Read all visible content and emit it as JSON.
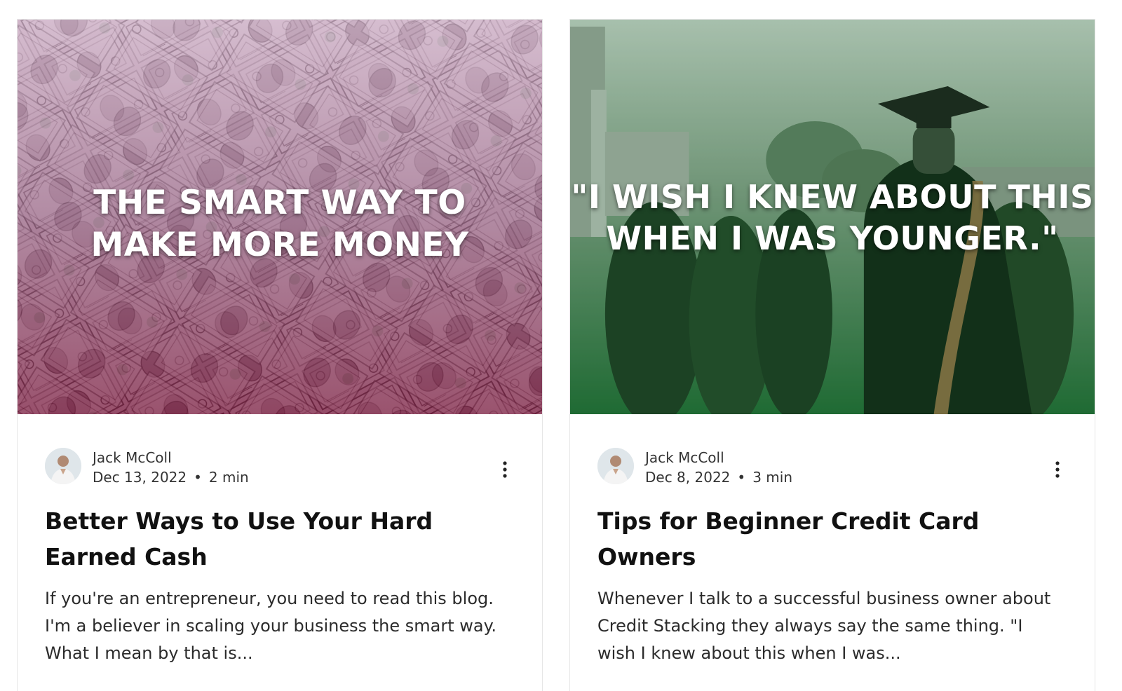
{
  "posts": [
    {
      "cover_text_line1": "THE SMART WAY TO",
      "cover_text_line2": "MAKE MORE MONEY",
      "author": "Jack McColl",
      "date": "Dec 13, 2022",
      "separator": "•",
      "read_time": "2 min",
      "title": "Better Ways to Use Your Hard Earned Cash",
      "excerpt": "If you're an entrepreneur, you need to read this blog. I'm a believer in scaling your business the smart way. What I mean by that is..."
    },
    {
      "cover_text_line1": "\"I WISH I KNEW ABOUT THIS",
      "cover_text_line2": "WHEN I WAS YOUNGER.\"",
      "author": "Jack McColl",
      "date": "Dec 8, 2022",
      "separator": "•",
      "read_time": "3 min",
      "title": "Tips for Beginner Credit Card Owners",
      "excerpt": "Whenever I talk to a successful business owner about Credit Stacking they always say the same thing. \"I wish I knew about this when I was..."
    }
  ],
  "colors": {
    "left_cover_top": "#c9a7c0",
    "left_cover_bottom": "#7a1c3e",
    "right_cover_top": "#b8c9bc",
    "right_cover_bottom": "#1f6b34",
    "title_text": "#111111",
    "body_text": "#2b2b2b"
  },
  "icons": {
    "more_menu": "more-vertical-icon",
    "avatar": "author-avatar"
  }
}
